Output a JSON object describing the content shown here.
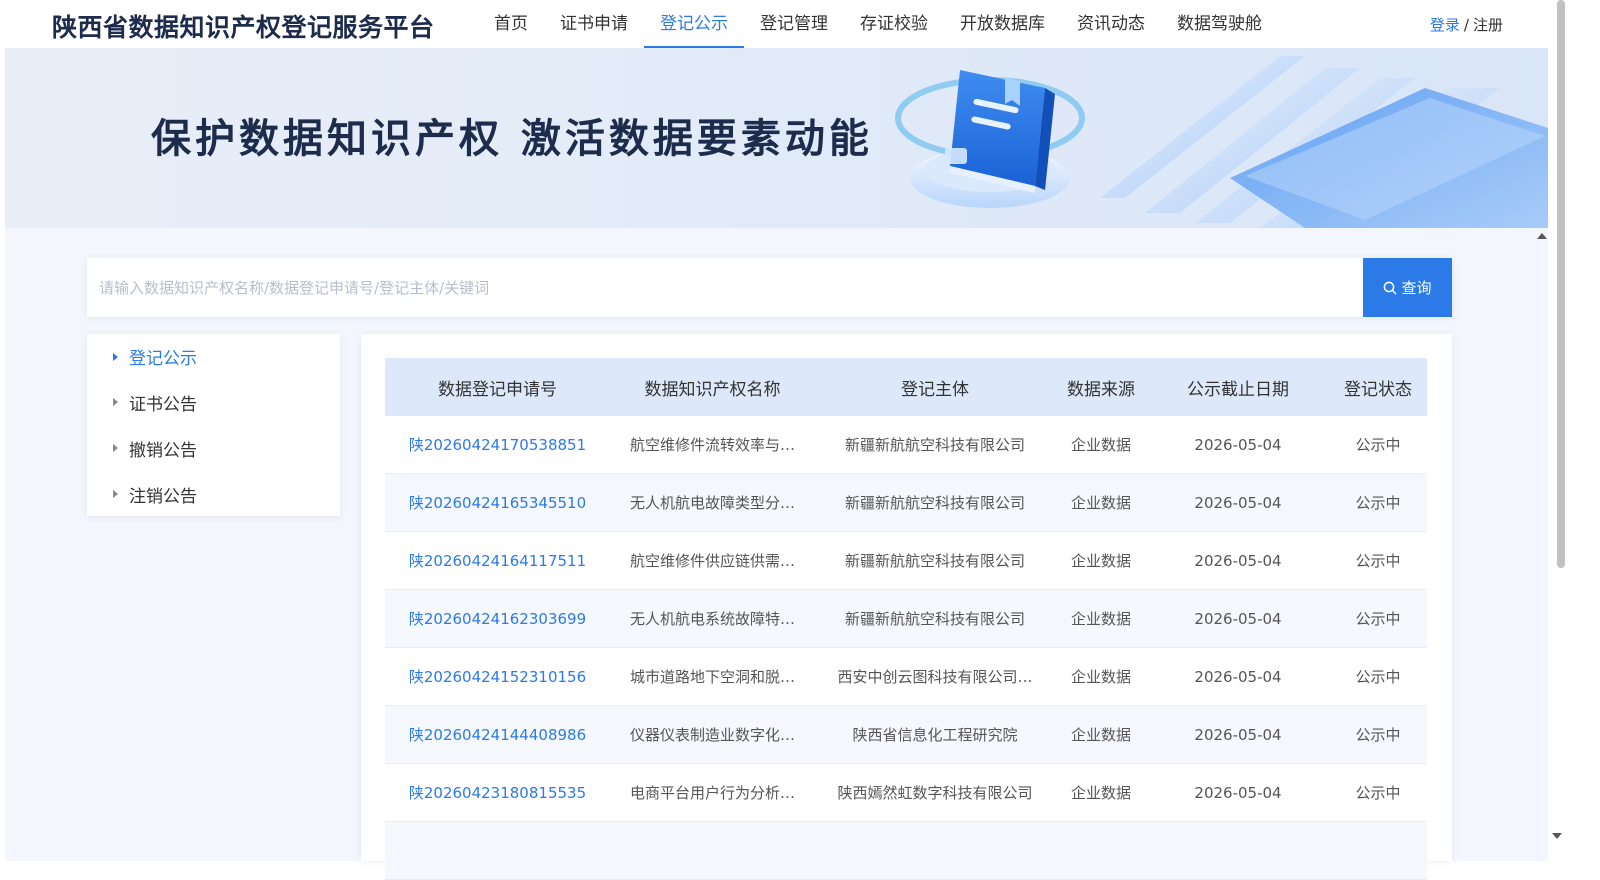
{
  "header": {
    "site_title": "陕西省数据知识产权登记服务平台",
    "nav": [
      {
        "label": "首页",
        "active": false
      },
      {
        "label": "证书申请",
        "active": false
      },
      {
        "label": "登记公示",
        "active": true
      },
      {
        "label": "登记管理",
        "active": false
      },
      {
        "label": "存证校验",
        "active": false
      },
      {
        "label": "开放数据库",
        "active": false
      },
      {
        "label": "资讯动态",
        "active": false
      },
      {
        "label": "数据驾驶舱",
        "active": false
      }
    ],
    "login_label": "登录",
    "separator": "/",
    "register_label": "注册"
  },
  "banner": {
    "slogan": "保护数据知识产权 激活数据要素动能"
  },
  "search": {
    "placeholder": "请输入数据知识产权名称/数据登记申请号/登记主体/关键词",
    "value": "",
    "button_label": "查询"
  },
  "sidebar": {
    "items": [
      {
        "label": "登记公示",
        "active": true
      },
      {
        "label": "证书公告",
        "active": false
      },
      {
        "label": "撤销公告",
        "active": false
      },
      {
        "label": "注销公告",
        "active": false
      }
    ]
  },
  "table": {
    "columns": [
      "数据登记申请号",
      "数据知识产权名称",
      "登记主体",
      "数据来源",
      "公示截止日期",
      "登记状态"
    ],
    "rows": [
      {
        "code": "陕20260424170538851",
        "name": "航空维修件流转效率与供应…",
        "entity": "新疆新航航空科技有限公司",
        "source": "企业数据",
        "deadline": "2026-05-04",
        "status": "公示中"
      },
      {
        "code": "陕20260424165345510",
        "name": "无人机航电故障类型分布与…",
        "entity": "新疆新航航空科技有限公司",
        "source": "企业数据",
        "deadline": "2026-05-04",
        "status": "公示中"
      },
      {
        "code": "陕20260424164117511",
        "name": "航空维修件供应链供需匹配…",
        "entity": "新疆新航航空科技有限公司",
        "source": "企业数据",
        "deadline": "2026-05-04",
        "status": "公示中"
      },
      {
        "code": "陕20260424162303699",
        "name": "无人机航电系统故障特征提…",
        "entity": "新疆新航航空科技有限公司",
        "source": "企业数据",
        "deadline": "2026-05-04",
        "status": "公示中"
      },
      {
        "code": "陕20260424152310156",
        "name": "城市道路地下空洞和脱空雷…",
        "entity": "西安中创云图科技有限公司…",
        "source": "企业数据",
        "deadline": "2026-05-04",
        "status": "公示中"
      },
      {
        "code": "陕20260424144408986",
        "name": "仪器仪表制造业数字化转型…",
        "entity": "陕西省信息化工程研究院",
        "source": "企业数据",
        "deadline": "2026-05-04",
        "status": "公示中"
      },
      {
        "code": "陕20260423180815535",
        "name": "电商平台用户行为分析数据集",
        "entity": "陕西嫣然虹数字科技有限公司",
        "source": "企业数据",
        "deadline": "2026-05-04",
        "status": "公示中"
      }
    ]
  },
  "colors": {
    "accent": "#2b7ae8",
    "title": "#1d2b4d",
    "table_header_bg": "#dde9fb",
    "page_bg": "#f3f6fc"
  }
}
